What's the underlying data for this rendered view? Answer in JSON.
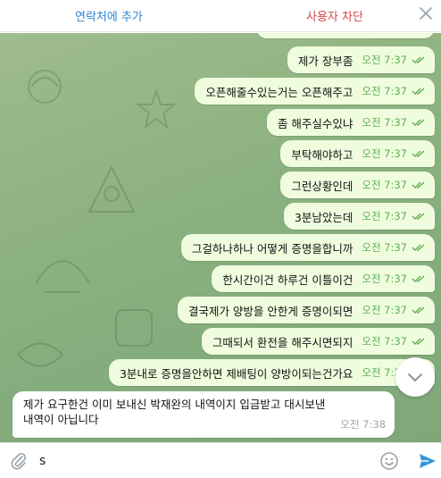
{
  "header": {
    "add_contact_label": "연락처에 추가",
    "block_user_label": "사용자 차단"
  },
  "messages_out": [
    {
      "text": "제가 장부좀",
      "time": "오전 7:37"
    },
    {
      "text": "오픈해줄수있는거는 오픈해주고",
      "time": "오전 7:37"
    },
    {
      "text": "좀 해주실수있냐",
      "time": "오전 7:37"
    },
    {
      "text": "부탁해야하고",
      "time": "오전 7:37"
    },
    {
      "text": "그런상황인데",
      "time": "오전 7:37"
    },
    {
      "text": "3분남았는데",
      "time": "오전 7:37"
    },
    {
      "text": "그걸하나하나 어떻게 증명을합니까",
      "time": "오전 7:37"
    },
    {
      "text": "한시간이건 하루건 이틀이건",
      "time": "오전 7:37"
    },
    {
      "text": "결국제가 양방을 안한게 증명이되면",
      "time": "오전 7:37"
    },
    {
      "text": "그때되서 환전을 해주시면되지",
      "time": "오전 7:37"
    },
    {
      "text": "3분내로 증명을안하면 제배팅이 양방이되는건가요",
      "time": "오전 7:38"
    }
  ],
  "message_in": {
    "line1": "제가 요구한건 이미 보내신 박재완의 내역이지 입금받고 대시보낸",
    "line2": "내역이 아닙니다",
    "time": "오전 7:38"
  },
  "composer": {
    "input_value": "s"
  },
  "colors": {
    "link_blue": "#2f86d1",
    "danger_red": "#d64545",
    "outgoing_bubble": "#effdde",
    "check_green": "#5fae54",
    "send_blue": "#3a95d8"
  },
  "icons": [
    "close-icon",
    "double-check-icon",
    "chevron-down-icon",
    "paperclip-icon",
    "emoji-icon",
    "send-icon"
  ]
}
